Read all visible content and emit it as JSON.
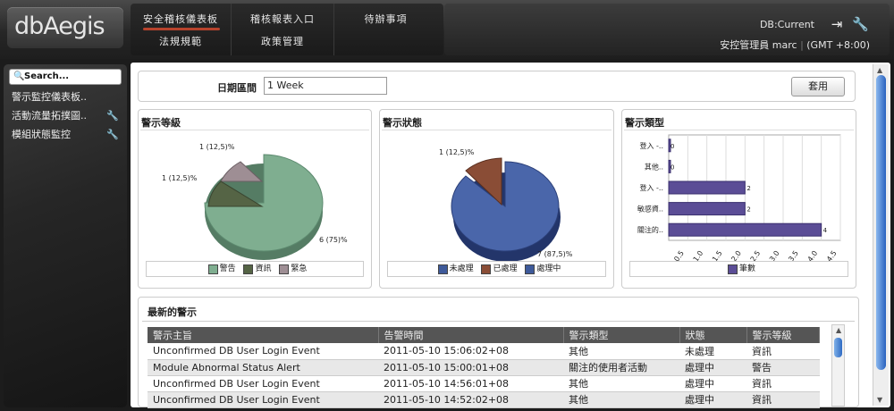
{
  "app": {
    "logo_text": "dbAegis"
  },
  "nav": {
    "row1": [
      "安全稽核儀表板",
      "稽核報表入口",
      "待辦事項"
    ],
    "row2": [
      "法規規範",
      "政策管理"
    ]
  },
  "topright": {
    "db_label": "DB:Current",
    "user": "安控管理員 marc",
    "timezone": "(GMT +8:00)"
  },
  "sidebar": {
    "search_placeholder": "Search...",
    "items": [
      {
        "label": "警示監控儀表板.."
      },
      {
        "label": "活動流量拓撲圖.."
      },
      {
        "label": "模組狀態監控"
      }
    ]
  },
  "filter": {
    "date_label": "日期區間",
    "date_value": "1 Week",
    "apply_label": "套用"
  },
  "charts": [
    {
      "title": "警示等級",
      "chart_data": {
        "type": "pie",
        "categories": [
          "警告",
          "資訊",
          "緊急"
        ],
        "values": [
          6,
          1,
          1
        ],
        "labels": [
          "6 (75)%",
          "1 (12,5)%",
          "1 (12,5)%"
        ],
        "colors": [
          "#7fae90",
          "#556445",
          "#9e8e94"
        ]
      }
    },
    {
      "title": "警示狀態",
      "chart_data": {
        "type": "pie",
        "categories": [
          "未處理",
          "已處理",
          "處理中"
        ],
        "values": [
          0,
          1,
          7
        ],
        "labels": [
          "",
          "1 (12,5)%",
          "7 (87,5)%"
        ],
        "colors": [
          "#3e5a9a",
          "#8a4d36",
          "#3e5a9a"
        ]
      }
    },
    {
      "title": "警示類型",
      "chart_data": {
        "type": "bar",
        "orientation": "horizontal",
        "categories": [
          "登入 -..",
          "其他..",
          "登入 -..",
          "敏感資..",
          "關注的.."
        ],
        "values": [
          0,
          0,
          2,
          2,
          4
        ],
        "value_labels": [
          "0",
          "0",
          "2",
          "2",
          "4"
        ],
        "xticks": [
          "0.5",
          "1.0",
          "1.5",
          "2.0",
          "2.5",
          "3.0",
          "3.5",
          "4.0",
          "4.5"
        ],
        "xlim": [
          0,
          4.5
        ],
        "series": [
          {
            "name": "筆數"
          }
        ],
        "color": "#5b4d96"
      }
    }
  ],
  "alerts": {
    "title": "最新的警示",
    "columns": [
      "警示主旨",
      "告警時間",
      "警示類型",
      "狀態",
      "警示等級"
    ],
    "rows": [
      [
        "Unconfirmed DB User Login Event",
        "2011-05-10 15:06:02+08",
        "其他",
        "未處理",
        "資訊"
      ],
      [
        "Module Abnormal Status Alert",
        "2011-05-10 15:00:01+08",
        "關注的使用者活動",
        "處理中",
        "警告"
      ],
      [
        "Unconfirmed DB User Login Event",
        "2011-05-10 14:56:01+08",
        "其他",
        "處理中",
        "資訊"
      ],
      [
        "Unconfirmed DB User Login Event",
        "2011-05-10 14:52:02+08",
        "其他",
        "處理中",
        "資訊"
      ]
    ]
  }
}
